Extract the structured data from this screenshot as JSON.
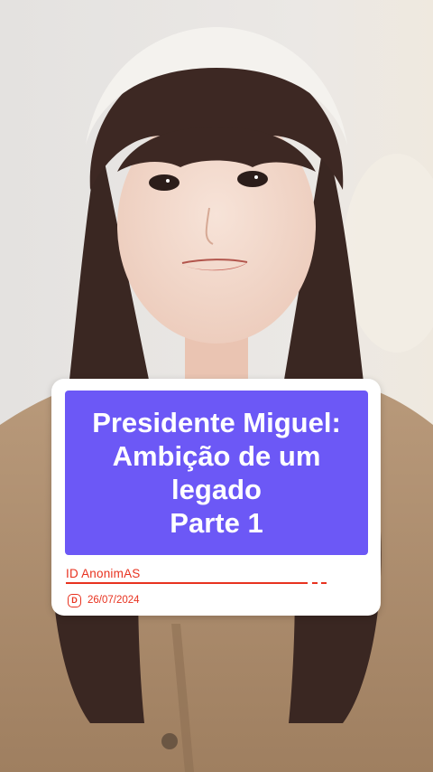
{
  "card": {
    "title_lines": [
      "Presidente Miguel:",
      "Ambição de um",
      "legado",
      "Parte 1"
    ],
    "id_label": "ID  AnonimAS",
    "date_icon_letter": "D",
    "date": "26/07/2024"
  },
  "colors": {
    "title_background": "#6c58f6",
    "accent": "#e8321f",
    "card_background": "#ffffff"
  },
  "icons": [
    "document-icon"
  ]
}
